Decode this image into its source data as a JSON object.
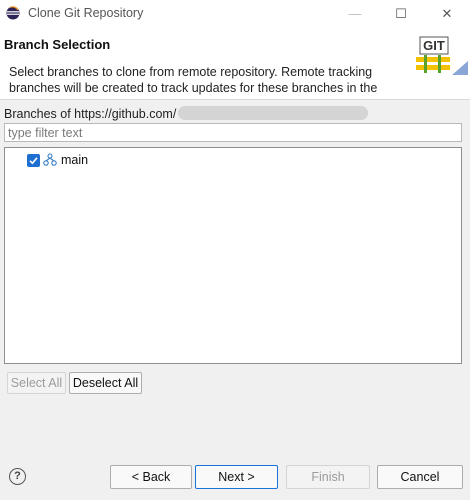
{
  "window": {
    "title": "Clone Git Repository",
    "minimize_glyph": "—",
    "maximize_glyph": "☐",
    "close_glyph": "✕"
  },
  "header": {
    "title": "Branch Selection",
    "description": "Select branches to clone from remote repository. Remote tracking branches will be created to track updates for these branches in the",
    "logo_text": "GIT"
  },
  "branches": {
    "label": "Branches of https://github.com/",
    "filter_placeholder": "type filter text",
    "items": [
      {
        "name": "main",
        "checked": true
      }
    ]
  },
  "selection_buttons": {
    "select_all": "Select All",
    "deselect_all": "Deselect All"
  },
  "footer": {
    "help_glyph": "?",
    "back": "< Back",
    "next": "Next >",
    "finish": "Finish",
    "cancel": "Cancel"
  },
  "colors": {
    "accent": "#1a73d9",
    "checkbox": "#1f6fd1"
  }
}
